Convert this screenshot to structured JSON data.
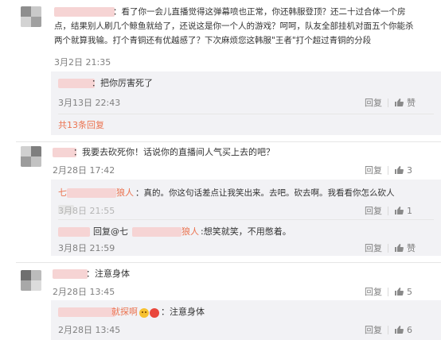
{
  "comment1": {
    "text_line1": "：看了你一会儿直播觉得这弹幕喷也正常，你还韩服登顶？还二十过合体一个房",
    "text_line2": "点，结果别人刷几个鲸鱼就给了，还说这是你一个人的游戏？呵呵，队友全部挂机对面五个你能杀",
    "text_line3": "两个就算我输。打个青铜还有优越感了？下次麻烦您这韩服\"王者\"打个超过青铜的分段",
    "time": "3月2日 21:35",
    "reply": {
      "text": "：把你厉害死了",
      "time": "3月13日 22:43",
      "reply_label": "回复",
      "like_count": "赞"
    },
    "expand": "共13条回复"
  },
  "comment2": {
    "text": "：我要去砍死你！话说你的直播间人气买上去的吧？",
    "time": "2月28日 17:42",
    "reply_label": "回复",
    "like_count": "3",
    "replies": [
      {
        "name_prefix": "七",
        "name_suffix": "狼人",
        "text": "：真的。你这句话差点让我笑出来。去吧。砍去啊。我看看你怎么砍人",
        "time": "3月8日 21:55",
        "reply_label": "回复",
        "like_count": "1"
      },
      {
        "reply_prefix": "回复@七",
        "name_suffix": "狼人",
        "text": ":想笑就笑，不用憋着。",
        "time": "3月8日 21:59",
        "reply_label": "回复",
        "like_count": "赞"
      }
    ]
  },
  "comment3": {
    "text": "：注意身体",
    "time": "2月28日 13:45",
    "reply_label": "回复",
    "like_count": "5",
    "reply": {
      "name_suffix": "就探啊",
      "text": "：注意身体",
      "time": "2月28日 13:45",
      "reply_label": "回复",
      "like_count": "6"
    }
  }
}
